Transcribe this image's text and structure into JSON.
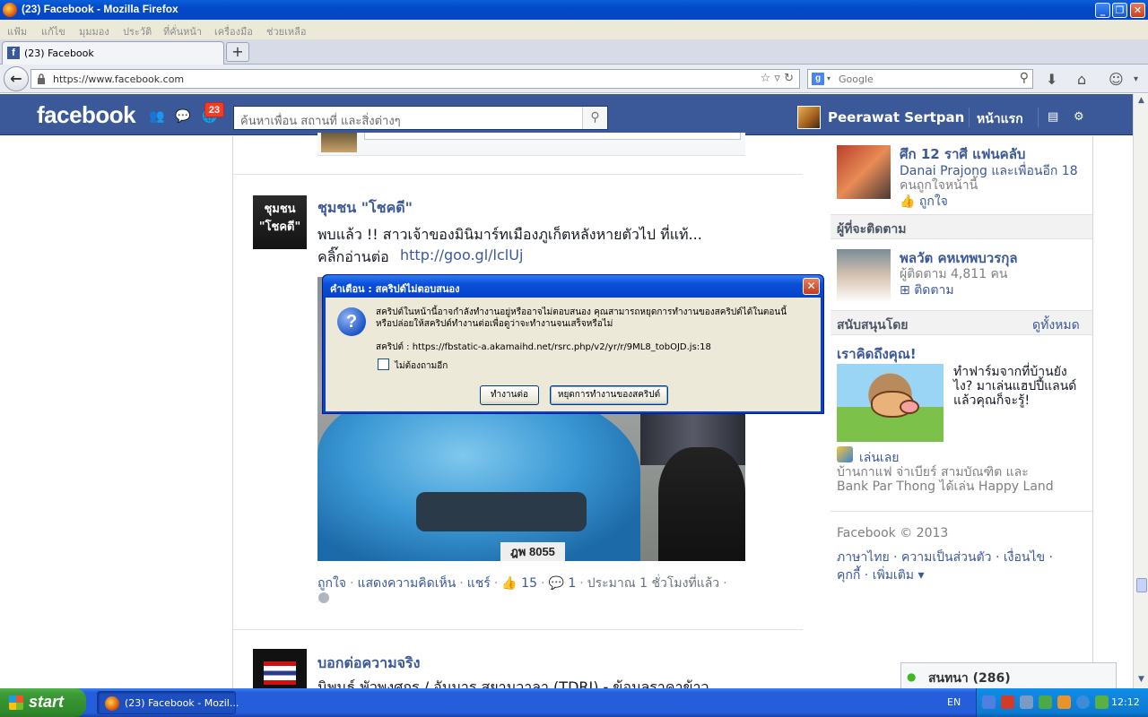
{
  "window": {
    "title": "(23) Facebook - Mozilla Firefox"
  },
  "menubar": {
    "items": [
      "แฟ้ม",
      "แก้ไข",
      "มุมมอง",
      "ประวัติ",
      "ที่คั่นหน้า",
      "เครื่องมือ",
      "ช่วยเหลือ"
    ]
  },
  "tab": {
    "label": "(23) Facebook",
    "new_tab": "+"
  },
  "navbar": {
    "url": "https://www.facebook.com",
    "search_placeholder": "Google",
    "search_engine": "g"
  },
  "fb": {
    "logo": "facebook",
    "notification_count": "23",
    "search_placeholder": "ค้นหาเพื่อน สถานที่ และสิ่งต่างๆ",
    "profile_name": "Peerawat Sertpan",
    "home_link": "หน้าแรก"
  },
  "post1": {
    "page_name": "ชุมชน \"โชคดี\"",
    "avatar_text": "ชุมชน \"โชคดี\"",
    "text": "พบแล้ว !! สาวเจ้าของมินิมาร์ทเมืองภูเก็ตหลังหายตัวไป ที่แท้...",
    "link_prefix": "คลิ๊กอ่านต่อ",
    "link": "http://goo.gl/lclUj",
    "plate": "ฎพ 8055",
    "actions": {
      "like": "ถูกใจ",
      "comment": "แสดงความคิดเห็น",
      "share": "แชร์",
      "likes": "15",
      "comments": "1",
      "time": "ประมาณ 1 ชั่วโมงที่แล้ว"
    }
  },
  "post2": {
    "page_name": "บอกต่อความจริง",
    "text": "นิพนธ์ พัวพงศกร / อัมมาร สยามวาลา (TDRI) - ข้อมูลราคาข้าว"
  },
  "right": {
    "suggest_title": "ศึก 12 ราศี แฟนคลับ",
    "suggest_friends": "Danai Prajong และเพื่อนอีก 18",
    "suggest_friends2": "คนถูกใจหน้านี้",
    "suggest_like": "ถูกใจ",
    "follow_header": "ผู้ที่จะติดตาม",
    "follow_name": "พลวัต คหเทพบวรกุล",
    "follow_count": "ผู้ติดตาม 4,811 คน",
    "follow_btn": "ติดตาม",
    "sponsored_header": "สนับสนุนโดย",
    "see_all": "ดูทั้งหมด",
    "ad_title": "เราคิดถึงคุณ!",
    "ad_text": [
      "ทำฟาร์มจากที่บ้านยัง",
      "ไง? มาเล่นแฮปปี้แลนด์",
      "แล้วคุณก็จะรู้!"
    ],
    "ad_play": "เล่นเลย",
    "ad_social": [
      "บ้านกาแฟ จ่าเบียร์ สามบัณฑิต และ",
      "Bank Par Thong ได้เล่น Happy Land"
    ],
    "footer_copy": "Facebook © 2013",
    "footer_links1": [
      "ภาษาไทย",
      "ความเป็นส่วนตัว",
      "เงื่อนไข"
    ],
    "footer_links2": [
      "คุกกี้",
      "เพิ่มเติม"
    ]
  },
  "chat": {
    "label": "สนทนา (286)"
  },
  "dialog": {
    "title": "คำเตือน : สคริปต์ไม่ตอบสนอง",
    "message1": "สคริปต์ในหน้านี้อาจกำลังทำงานอยู่หรืออาจไม่ตอบสนอง คุณสามารถหยุดการทำงานของสคริปต์ได้ในตอนนี้",
    "message2": "หรือปล่อยให้สคริปต์ทำงานต่อเพื่อดูว่าจะทำงานจนเสร็จหรือไม่",
    "script": "สคริปต์ : https://fbstatic-a.akamaihd.net/rsrc.php/v2/yr/r/9ML8_tobOJD.js:18",
    "checkbox_label": "ไม่ต้องถามอีก",
    "continue_btn": "ทำงานต่อ",
    "stop_btn": "หยุดการทำงานของสคริปต์"
  },
  "taskbar": {
    "start": "start",
    "task_label": "(23) Facebook - Mozil...",
    "lang": "EN",
    "clock": "12:12"
  }
}
